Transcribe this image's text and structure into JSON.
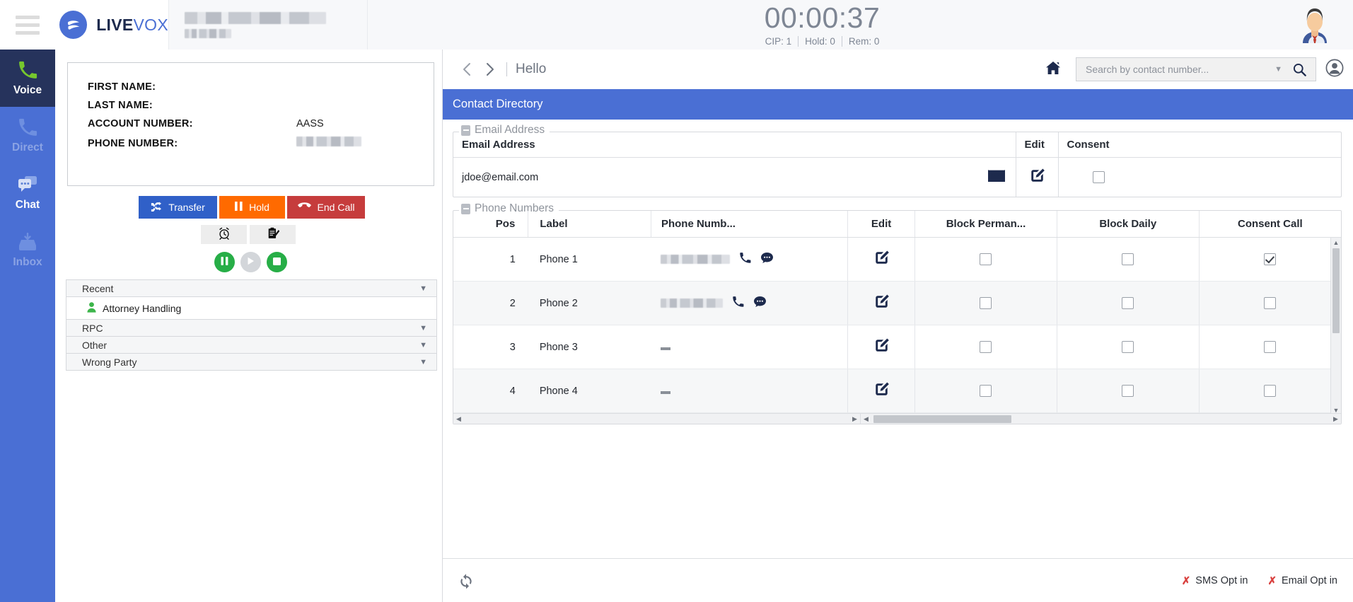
{
  "topbar": {
    "menu_icon": "hamburger-icon",
    "brand_live": "LIVE",
    "brand_vox": "VOX",
    "account_redacted": true,
    "timer": "00:00:37",
    "stats": [
      {
        "label": "CIP: 1"
      },
      {
        "label": "Hold: 0"
      },
      {
        "label": "Rem: 0"
      }
    ],
    "avatar_icon": "user-avatar"
  },
  "sidebar": {
    "items": [
      {
        "label": "Voice",
        "icon": "phone-icon",
        "state": "active"
      },
      {
        "label": "Direct",
        "icon": "phone-icon",
        "state": "dim"
      },
      {
        "label": "Chat",
        "icon": "chat-icon",
        "state": "lit"
      },
      {
        "label": "Inbox",
        "icon": "inbox-icon",
        "state": "dim"
      }
    ]
  },
  "contact_info": {
    "rows": [
      {
        "label": "FIRST NAME:",
        "value": "",
        "redacted": false
      },
      {
        "label": "LAST NAME:",
        "value": "",
        "redacted": false
      },
      {
        "label": "ACCOUNT NUMBER:",
        "value": "AASS",
        "redacted": false
      },
      {
        "label": "PHONE NUMBER:",
        "value": "",
        "redacted": true
      }
    ]
  },
  "call_controls": {
    "transfer_label": "Transfer",
    "hold_label": "Hold",
    "end_label": "End Call",
    "transfer_color": "#3060c8",
    "hold_color": "#ff6a00",
    "end_color": "#c63c3c",
    "util": [
      {
        "icon": "alarm-clock-icon"
      },
      {
        "icon": "clipboard-edit-icon"
      }
    ],
    "media": [
      {
        "icon": "pause-icon",
        "color": "#27ae47"
      },
      {
        "icon": "play-icon",
        "color": "#d3d6da"
      },
      {
        "icon": "stop-icon",
        "color": "#27ae47"
      }
    ]
  },
  "dispositions": {
    "sections": [
      {
        "title": "Recent",
        "expanded": true,
        "items": [
          {
            "label": "Attorney Handling",
            "icon": "person-icon"
          }
        ]
      },
      {
        "title": "RPC",
        "expanded": false,
        "items": []
      },
      {
        "title": "Other",
        "expanded": false,
        "items": []
      },
      {
        "title": "Wrong Party",
        "expanded": false,
        "items": []
      }
    ]
  },
  "right_toolbar": {
    "back_icon": "chevron-left-icon",
    "forward_icon": "chevron-right-icon",
    "title": "Hello",
    "home_icon": "home-icon",
    "search_placeholder": "Search by contact number...",
    "search_value": "",
    "caret_icon": "chevron-down-icon",
    "search_icon": "search-icon",
    "user_icon": "account-circle-icon"
  },
  "panel": {
    "title": "Contact Directory",
    "title_bg": "#4a6fd4"
  },
  "email_section": {
    "legend": "Email Address",
    "columns": [
      "Email Address",
      "Edit",
      "Consent"
    ],
    "rows": [
      {
        "email": "jdoe@email.com",
        "mail_icon": "envelope-icon",
        "edit_icon": "pencil-square-icon",
        "consent": false
      }
    ]
  },
  "phone_section": {
    "legend": "Phone Numbers",
    "columns": [
      "Pos",
      "Label",
      "Phone Numb...",
      "Edit",
      "Block Perman...",
      "Block Daily",
      "Consent Call"
    ],
    "rows": [
      {
        "pos": "1",
        "label": "Phone 1",
        "number": "",
        "redacted": true,
        "call_icon": "phone-icon",
        "sms_icon": "sms-bubble-icon",
        "edit_icon": "pencil-square-icon",
        "block_permanent": false,
        "block_daily": false,
        "consent_call": true
      },
      {
        "pos": "2",
        "label": "Phone 2",
        "number": "",
        "redacted": true,
        "call_icon": "phone-icon",
        "sms_icon": "sms-bubble-icon",
        "edit_icon": "pencil-square-icon",
        "block_permanent": false,
        "block_daily": false,
        "consent_call": false
      },
      {
        "pos": "3",
        "label": "Phone 3",
        "number": "—",
        "redacted": false,
        "call_icon": "",
        "sms_icon": "",
        "edit_icon": "pencil-square-icon",
        "block_permanent": false,
        "block_daily": false,
        "consent_call": false
      },
      {
        "pos": "4",
        "label": "Phone 4",
        "number": "—",
        "redacted": false,
        "call_icon": "",
        "sms_icon": "",
        "edit_icon": "pencil-square-icon",
        "block_permanent": false,
        "block_daily": false,
        "consent_call": false
      }
    ]
  },
  "footer": {
    "refresh_icon": "refresh-icon",
    "sms_optin_label": "SMS Opt in",
    "email_optin_label": "Email Opt in",
    "mark_color": "#d9413f"
  }
}
